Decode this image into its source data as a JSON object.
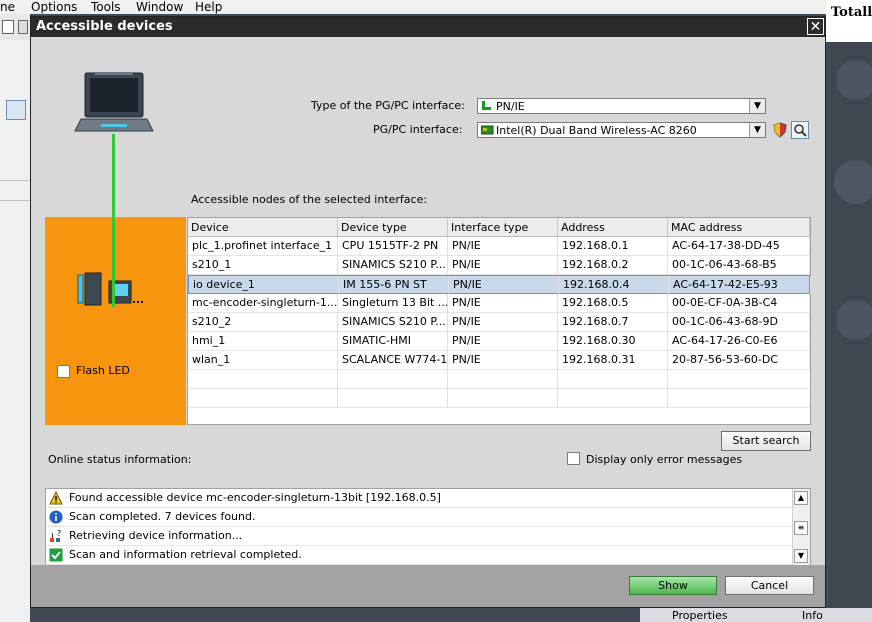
{
  "menu": [
    "ne",
    "Options",
    "Tools",
    "Window",
    "Help"
  ],
  "app_right_title": "Totally",
  "bottom_tabs": [
    "Properties",
    "Info"
  ],
  "dialog": {
    "title": "Accessible devices",
    "close_label": "✕",
    "pgpc_type_label": "Type of the PG/PC interface:",
    "pgpc_type_value": "PN/IE",
    "pgpc_interface_label": "PG/PC interface:",
    "pgpc_interface_value": "Intel(R) Dual Band Wireless-AC 8260",
    "nodes_label": "Accessible nodes of the selected interface:",
    "flash_led_label": "Flash LED",
    "columns": [
      "Device",
      "Device type",
      "Interface type",
      "Address",
      "MAC address"
    ],
    "rows": [
      [
        "plc_1.profinet interface_1",
        "CPU 1515TF-2 PN",
        "PN/IE",
        "192.168.0.1",
        "AC-64-17-38-DD-45"
      ],
      [
        "s210_1",
        "SINAMICS S210 P...",
        "PN/IE",
        "192.168.0.2",
        "00-1C-06-43-68-B5"
      ],
      [
        "io device_1",
        "IM 155-6 PN ST",
        "PN/IE",
        "192.168.0.4",
        "AC-64-17-42-E5-93"
      ],
      [
        "mc-encoder-singleturn-1...",
        "Singleturn 13 Bit ...",
        "PN/IE",
        "192.168.0.5",
        "00-0E-CF-0A-3B-C4"
      ],
      [
        "s210_2",
        "SINAMICS S210 P...",
        "PN/IE",
        "192.168.0.7",
        "00-1C-06-43-68-9D"
      ],
      [
        "hmi_1",
        "SIMATIC-HMI",
        "PN/IE",
        "192.168.0.30",
        "AC-64-17-26-C0-E6"
      ],
      [
        "wlan_1",
        "SCALANCE W774-1",
        "PN/IE",
        "192.168.0.31",
        "20-87-56-53-60-DC"
      ]
    ],
    "start_search_label": "Start search",
    "online_status_label": "Online status information:",
    "error_only_label": "Display only error messages",
    "log": [
      {
        "icon": "warning-icon",
        "text": "Found accessible device mc-encoder-singleturn-13bit [192.168.0.5]"
      },
      {
        "icon": "info-icon",
        "text": "Scan completed. 7 devices found."
      },
      {
        "icon": "network-search-icon",
        "text": "Retrieving device information..."
      },
      {
        "icon": "check-icon",
        "text": "Scan and information retrieval completed."
      }
    ],
    "show_label": "Show",
    "cancel_label": "Cancel"
  },
  "colors": {
    "accent_orange": "#f7950f",
    "link_green": "#30c830",
    "selected_row": "#c9d9ea"
  }
}
